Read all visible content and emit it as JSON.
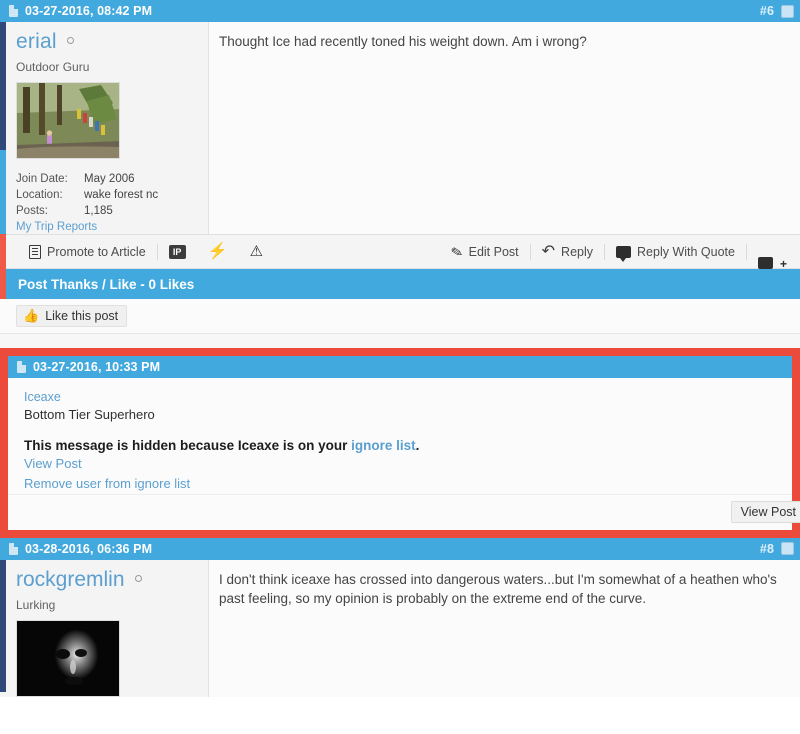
{
  "posts": [
    {
      "id": "post-6",
      "date": "03-27-2016, 08:42 PM",
      "number": "#6",
      "username": "erial",
      "rank": "Outdoor Guru",
      "stats": [
        {
          "key": "Join Date:",
          "value": "May 2006"
        },
        {
          "key": "Location:",
          "value": "wake forest nc"
        },
        {
          "key": "Posts:",
          "value": "1,185"
        }
      ],
      "profile_link": "My Trip Reports",
      "message": "Thought Ice had recently toned his weight down. Am i wrong?"
    },
    {
      "id": "post-7-ignored",
      "date": "03-27-2016, 10:33 PM",
      "username": "Iceaxe",
      "rank": "Bottom Tier Superhero",
      "hidden_prefix": "This message is hidden because Iceaxe is on your ",
      "hidden_link": "ignore list",
      "hidden_suffix": ".",
      "view_post_link": "View Post",
      "remove_ignore_link": "Remove user from ignore list",
      "view_post_button": "View Post"
    },
    {
      "id": "post-8",
      "date": "03-28-2016, 06:36 PM",
      "number": "#8",
      "username": "rockgremlin",
      "rank": "Lurking",
      "message": "I don't think iceaxe has crossed into dangerous waters...but I'm somewhat of a heathen who's past feeling, so my opinion is probably on the extreme end of the curve."
    }
  ],
  "toolbar": {
    "promote_label": "Promote to Article",
    "ip_label": "IP",
    "bolt_glyph": "⚡",
    "warn_glyph": "⚠",
    "edit_label": "Edit Post",
    "reply_label": "Reply",
    "reply_glyph": "↶",
    "quote_label": "Reply With Quote",
    "pencil_glyph": "✎"
  },
  "likes": {
    "header": "Post Thanks / Like - 0 Likes",
    "button_label": "Like this post",
    "thumb_glyph": "👍"
  },
  "colors": {
    "header_blue": "#41a9de",
    "highlight_red": "#ec4b3c",
    "accent_orange": "#ef5a48",
    "link_blue": "#5b9fd0",
    "navy": "#2f4a7a"
  }
}
